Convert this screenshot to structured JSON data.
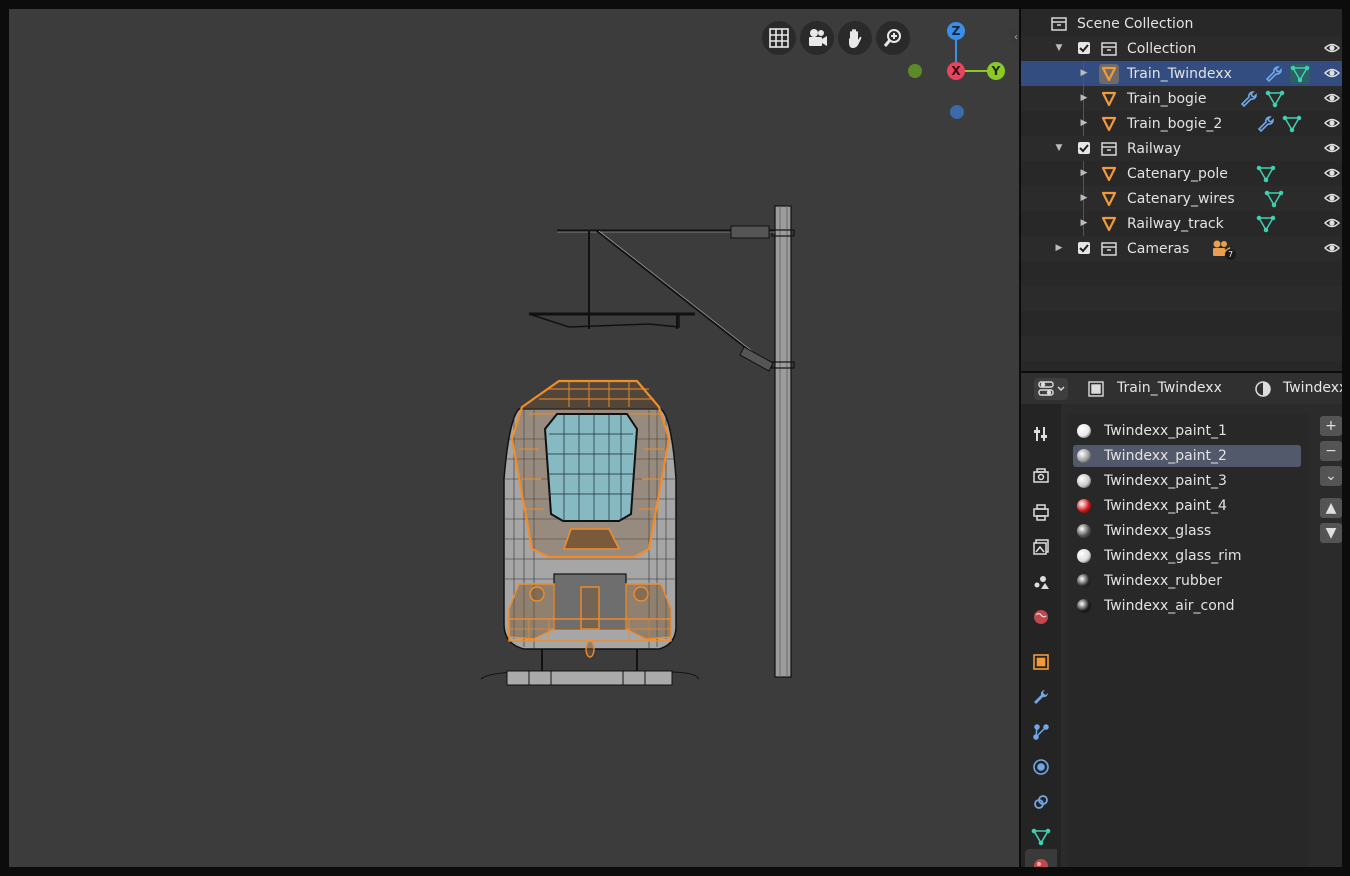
{
  "viewport": {
    "nav_buttons": [
      {
        "name": "toggle-ortho-grid-button",
        "icon": "grid-icon"
      },
      {
        "name": "camera-view-button",
        "icon": "camera-icon"
      },
      {
        "name": "pan-view-button",
        "icon": "hand-icon"
      },
      {
        "name": "zoom-view-button",
        "icon": "zoom-icon"
      }
    ],
    "gizmo": {
      "z_label": "Z",
      "x_label": "X",
      "y_label": "Y",
      "colors": {
        "x": "#e5455f",
        "y": "#8ac926",
        "z": "#3b8fe6",
        "neg_y": "#5d8a29",
        "neg_z": "#3a6aa8"
      }
    },
    "colors": {
      "background": "#3c3c3c",
      "selection": "#f28c28",
      "wire": "#1a1a1a",
      "glass": "#86b9c2"
    }
  },
  "outliner": {
    "root": "Scene Collection",
    "rows": [
      {
        "label": "Collection",
        "type": "collection",
        "level": 1,
        "expanded": true,
        "checked": true
      },
      {
        "label": "Train_Twindexx",
        "type": "object",
        "level": 2,
        "selected": true,
        "modifier": true,
        "mesh": true,
        "mesh_active": true
      },
      {
        "label": "Train_bogie",
        "type": "object",
        "level": 2,
        "modifier": true,
        "mesh": true
      },
      {
        "label": "Train_bogie_2",
        "type": "object",
        "level": 2,
        "modifier": true,
        "mesh": true
      },
      {
        "label": "Railway",
        "type": "collection",
        "level": 1,
        "expanded": true,
        "checked": true
      },
      {
        "label": "Catenary_pole",
        "type": "object",
        "level": 2,
        "mesh": true
      },
      {
        "label": "Catenary_wires",
        "type": "object",
        "level": 2,
        "mesh": true
      },
      {
        "label": "Railway_track",
        "type": "object",
        "level": 2,
        "mesh": true
      },
      {
        "label": "Cameras",
        "type": "collection",
        "level": 1,
        "expanded": false,
        "checked": true,
        "camera_count": "7"
      }
    ]
  },
  "properties": {
    "breadcrumb_object": "Train_Twindexx",
    "breadcrumb_material": "Twindexx",
    "tabs": [
      "tool-icon",
      "render-icon",
      "output-icon",
      "view-layer-icon",
      "scene-icon",
      "world-icon",
      "object-icon",
      "modifier-icon",
      "particles-icon",
      "physics-icon",
      "constraints-icon",
      "data-icon",
      "material-icon"
    ],
    "materials": [
      {
        "name": "Twindexx_paint_1",
        "color": "#e8e8e8"
      },
      {
        "name": "Twindexx_paint_2",
        "color": "#9a9a9a",
        "selected": true
      },
      {
        "name": "Twindexx_paint_3",
        "color": "#c8c8c8"
      },
      {
        "name": "Twindexx_paint_4",
        "color": "#d01818"
      },
      {
        "name": "Twindexx_glass",
        "color": "#555555"
      },
      {
        "name": "Twindexx_glass_rim",
        "color": "#dcdcdc"
      },
      {
        "name": "Twindexx_rubber",
        "color": "#2a2a2a"
      },
      {
        "name": "Twindexx_air_cond",
        "color": "#1c1c1c"
      }
    ],
    "side_buttons": [
      "+",
      "−",
      "⌄",
      "▲",
      "▼"
    ]
  }
}
